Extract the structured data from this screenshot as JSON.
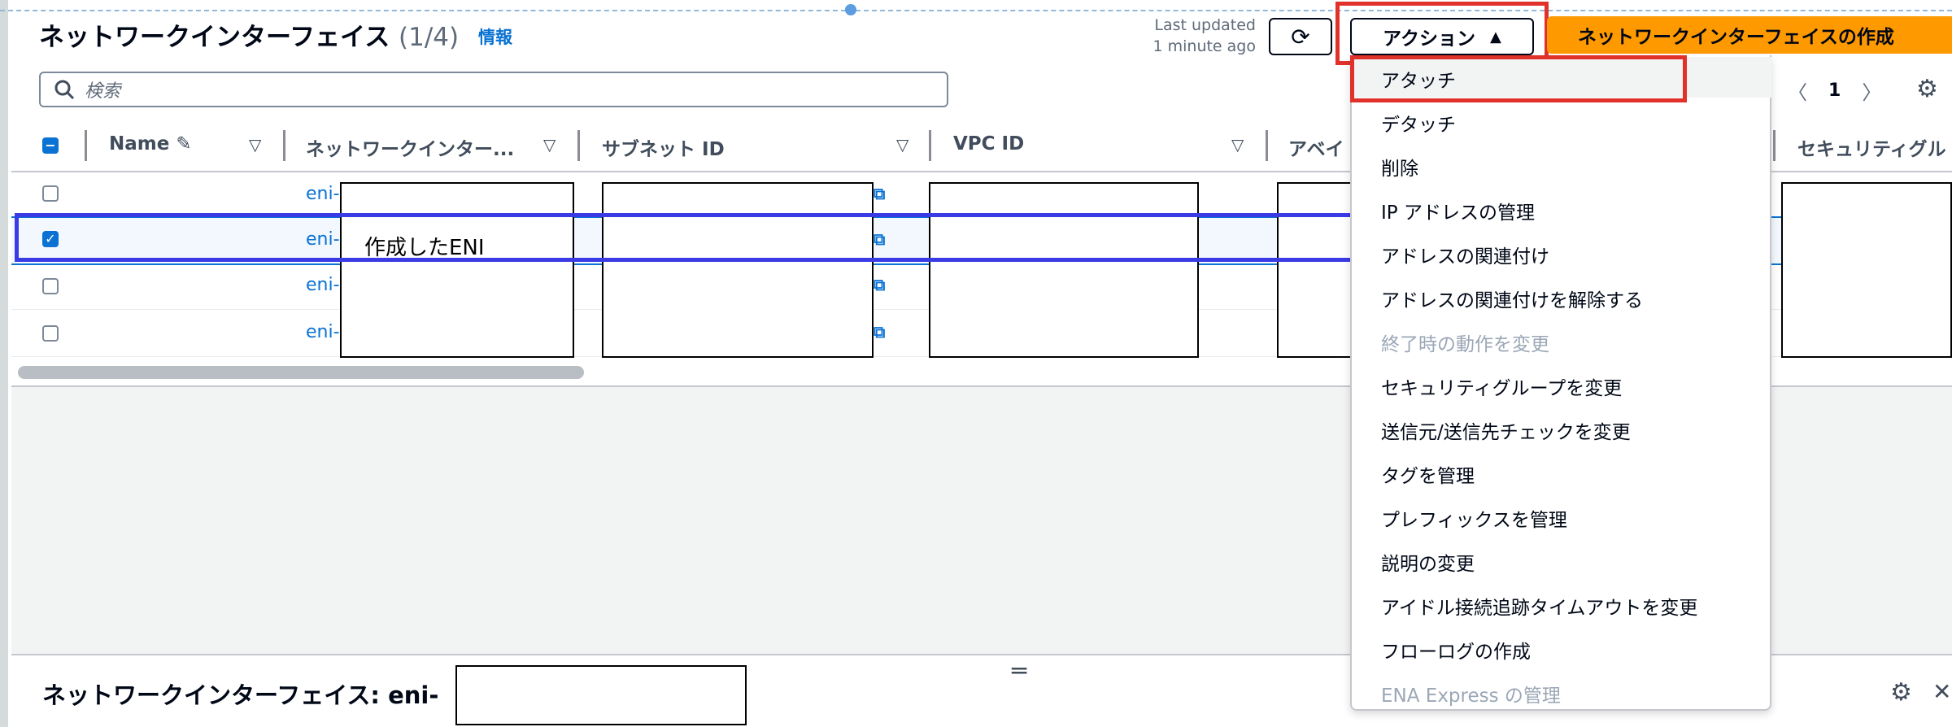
{
  "header": {
    "title": "ネットワークインターフェイス",
    "count": "(1/4)",
    "info_link": "情報",
    "last_updated_line1": "Last updated",
    "last_updated_line2": "1 minute ago",
    "actions_label": "アクション",
    "create_label": "ネットワークインターフェイスの作成"
  },
  "search": {
    "placeholder": "検索"
  },
  "pagination": {
    "page": "1"
  },
  "table": {
    "columns": [
      "Name",
      "ネットワークインター...",
      "サブネット ID",
      "VPC ID",
      "アベイ",
      "セキュリティグル"
    ],
    "rows": [
      {
        "eni": "eni-",
        "selected": false
      },
      {
        "eni": "eni-",
        "selected": true
      },
      {
        "eni": "eni-",
        "selected": false
      },
      {
        "eni": "eni-",
        "selected": false
      }
    ]
  },
  "annotation": {
    "note": "作成したENI"
  },
  "menu": {
    "items": [
      {
        "label": "アタッチ",
        "disabled": false
      },
      {
        "label": "デタッチ",
        "disabled": false
      },
      {
        "label": "削除",
        "disabled": false
      },
      {
        "label": "IP アドレスの管理",
        "disabled": false
      },
      {
        "label": "アドレスの関連付け",
        "disabled": false
      },
      {
        "label": "アドレスの関連付けを解除する",
        "disabled": false
      },
      {
        "label": "終了時の動作を変更",
        "disabled": true
      },
      {
        "label": "セキュリティグループを変更",
        "disabled": false
      },
      {
        "label": "送信元/送信先チェックを変更",
        "disabled": false
      },
      {
        "label": "タグを管理",
        "disabled": false
      },
      {
        "label": "プレフィックスを管理",
        "disabled": false
      },
      {
        "label": "説明の変更",
        "disabled": false
      },
      {
        "label": "アイドル接続追跡タイムアウトを変更",
        "disabled": false
      },
      {
        "label": "フローログの作成",
        "disabled": false
      },
      {
        "label": "ENA Express の管理",
        "disabled": true
      }
    ]
  },
  "details": {
    "title": "ネットワークインターフェイス: eni-"
  },
  "colors": {
    "accent": "#0972d3",
    "primary_button": "#ff9900",
    "annotation_red": "#e0322a",
    "annotation_blue": "#3b3be6"
  }
}
